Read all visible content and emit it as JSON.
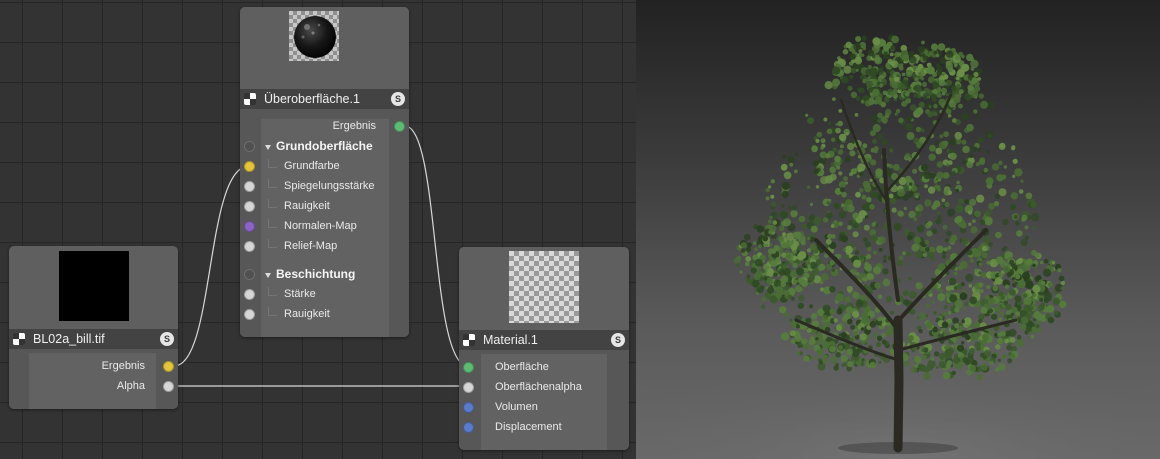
{
  "nodes": {
    "ueberoberflaeche": {
      "title": "Überoberfläche.1",
      "badge": "S",
      "output": "Ergebnis",
      "groups": [
        {
          "label": "Grundoberfläche",
          "inputs": [
            "Grundfarbe",
            "Spiegelungsstärke",
            "Rauigkeit",
            "Normalen-Map",
            "Relief-Map"
          ]
        },
        {
          "label": "Beschichtung",
          "inputs": [
            "Stärke",
            "Rauigkeit"
          ]
        }
      ]
    },
    "bitmap": {
      "title": "BL02a_bill.tif",
      "badge": "S",
      "outputs": [
        "Ergebnis",
        "Alpha"
      ]
    },
    "material": {
      "title": "Material.1",
      "badge": "S",
      "inputs": [
        "Oberfläche",
        "Oberflächenalpha",
        "Volumen",
        "Displacement"
      ]
    }
  },
  "colors": {
    "port_green": "#5dbb73",
    "port_yellow": "#e3c43a",
    "port_white": "#d6d6d6",
    "port_purple": "#8a63c4",
    "port_blue": "#5a7bc8",
    "port_hollow": "#505050",
    "wire": "#d8d8d8"
  },
  "icons": {
    "node_type": "checker-icon",
    "solo_badge": "solo-badge-icon"
  }
}
